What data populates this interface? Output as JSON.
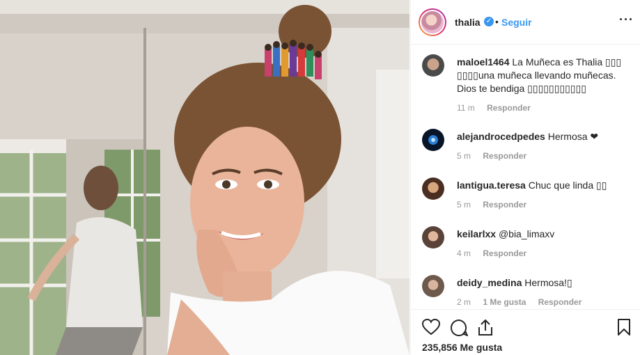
{
  "post": {
    "username": "thalia",
    "verified_icon": "verified-check-icon",
    "separator": "•",
    "follow_label": "Seguir",
    "more_icon": "more-options-icon",
    "more_label": "···"
  },
  "comments": [
    {
      "user": "maloel1464",
      "text": "La Muñeca es Thalia ▯▯▯ ▯▯▯▯una muñeca llevando muñecas. Dios te bendiga ▯▯▯▯▯▯▯▯▯▯▯",
      "time": "11 m",
      "likes": "",
      "reply": "Responder"
    },
    {
      "user": "alejandrocedpedes",
      "text": "Hermosa ❤",
      "time": "5 m",
      "likes": "",
      "reply": "Responder"
    },
    {
      "user": "lantigua.teresa",
      "text": "Chuc que linda ▯▯",
      "time": "5 m",
      "likes": "",
      "reply": "Responder"
    },
    {
      "user": "keilarlxx",
      "text": "@bia_limaxv",
      "time": "4 m",
      "likes": "",
      "reply": "Responder"
    },
    {
      "user": "deidy_medina",
      "text": "Hermosa!▯",
      "time": "2 m",
      "likes": "1 Me gusta",
      "reply": "Responder"
    }
  ],
  "actions": {
    "like_icon": "heart-icon",
    "comment_icon": "comment-icon",
    "share_icon": "share-icon",
    "save_icon": "bookmark-icon",
    "likes_count": "235,856 Me gusta"
  },
  "colors": {
    "accent": "#3897f0",
    "meta": "#999999",
    "text": "#262626"
  }
}
